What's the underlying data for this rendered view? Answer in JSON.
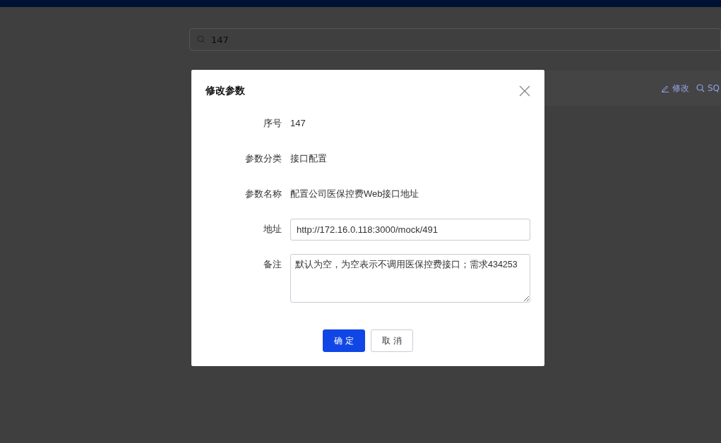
{
  "search": {
    "value": "147"
  },
  "row_actions": [
    {
      "kind": "edit",
      "label": "修改"
    },
    {
      "kind": "search",
      "label": "SQ"
    }
  ],
  "dialog": {
    "title": "修改参数",
    "fields": [
      {
        "kind": "text",
        "label": "序号",
        "value": "147"
      },
      {
        "kind": "text",
        "label": "参数分类",
        "value": "接口配置"
      },
      {
        "kind": "text",
        "label": "参数名称",
        "value": "配置公司医保控费Web接口地址"
      },
      {
        "kind": "input",
        "label": "地址",
        "value": "http://172.16.0.118:3000/mock/491"
      },
      {
        "kind": "textarea",
        "label": "备注",
        "value": "默认为空，为空表示不调用医保控费接口；需求434253"
      }
    ],
    "buttons": [
      {
        "kind": "primary",
        "label": "确 定"
      },
      {
        "kind": "default",
        "label": "取 消"
      }
    ]
  }
}
